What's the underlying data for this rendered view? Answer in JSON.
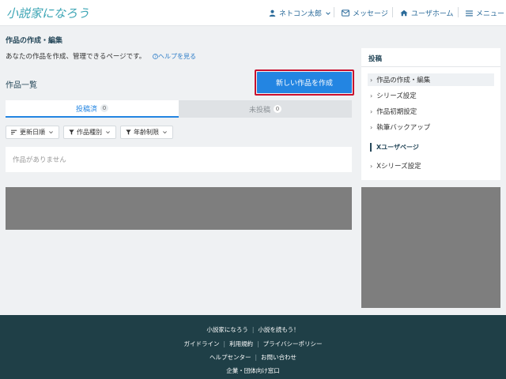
{
  "header": {
    "logo": "小説家になろう",
    "user": "ネトコン太郎",
    "messages": "メッセージ",
    "user_home": "ユーザホーム",
    "menu": "メニュー"
  },
  "page": {
    "breadcrumb": "作品の作成・編集",
    "description": "あなたの作品を作成、管理できるページです。",
    "help_link": "ヘルプを見る",
    "list_title": "作品一覧",
    "new_button": "新しい作品を作成",
    "tabs": [
      {
        "label": "投稿済",
        "count": "0"
      },
      {
        "label": "未投稿",
        "count": "0"
      }
    ],
    "filters": [
      "更新日順",
      "作品種別",
      "年齢制限"
    ],
    "empty_message": "作品がありません"
  },
  "sidebar": {
    "heading": "投稿",
    "items": [
      "作品の作成・編集",
      "シリーズ設定",
      "作品初期設定",
      "執筆バックアップ"
    ],
    "section": "Xユーザページ",
    "section_items": [
      "Xシリーズ設定"
    ]
  },
  "footer": {
    "row1": [
      "小説家になろう",
      "小説を読もう！"
    ],
    "row2": [
      "ガイドライン",
      "利用規約",
      "プライバシーポリシー"
    ],
    "row3": [
      "ヘルプセンター",
      "お問い合わせ"
    ],
    "row4": [
      "企業・団体向け窓口"
    ]
  },
  "colors": {
    "accent": "#2385e2",
    "header_text": "#2b6b9a",
    "footer_bg": "#1f3f47",
    "highlight": "#c8102e"
  }
}
